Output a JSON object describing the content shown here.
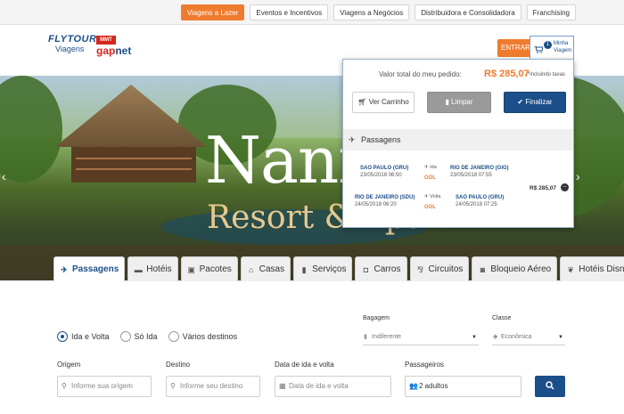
{
  "topnav": {
    "items": [
      {
        "label": "Viagens a Lazer",
        "active": true
      },
      {
        "label": "Eventos e Incentivos",
        "active": false
      },
      {
        "label": "Viagens a Negócios",
        "active": false
      },
      {
        "label": "Distribuidora e Consolidadora",
        "active": false
      },
      {
        "label": "Franchising",
        "active": false
      }
    ]
  },
  "header": {
    "logo_flytour": "FLYTOUR",
    "logo_flytour_sub": "Viagens",
    "logo_mmt": "MMT",
    "logo_gap": "gap",
    "logo_net": "net",
    "entrar_label": "ENTRAR",
    "cart_count": "1",
    "cart_label": "Minha Viagem"
  },
  "hero": {
    "resort_name": "Nann",
    "resort_sub": "Resort & Spa"
  },
  "tabs": [
    {
      "label": "Passagens",
      "icon": "plane-icon",
      "glyph": "✈",
      "active": true
    },
    {
      "label": "Hotéis",
      "icon": "bed-icon",
      "glyph": "▬",
      "active": false
    },
    {
      "label": "Pacotes",
      "icon": "package-icon",
      "glyph": "▣",
      "active": false
    },
    {
      "label": "Casas",
      "icon": "house-icon",
      "glyph": "⌂",
      "active": false
    },
    {
      "label": "Serviços",
      "icon": "service-icon",
      "glyph": "▮",
      "active": false
    },
    {
      "label": "Carros",
      "icon": "car-icon",
      "glyph": "◘",
      "active": false
    },
    {
      "label": "Circuitos",
      "icon": "circuit-icon",
      "glyph": "⅋",
      "active": false
    },
    {
      "label": "Bloqueio Aéreo",
      "icon": "flight-block-icon",
      "glyph": "◙",
      "active": false
    },
    {
      "label": "Hotéis Disney",
      "icon": "disney-icon",
      "glyph": "❦",
      "active": false
    }
  ],
  "search": {
    "trip_types": [
      {
        "label": "Ida e Volta",
        "selected": true
      },
      {
        "label": "Só Ida",
        "selected": false
      },
      {
        "label": "Vários destinos",
        "selected": false
      }
    ],
    "bagagem_label": "Bagagem",
    "bagagem_value": "Indiferente",
    "classe_label": "Classe",
    "classe_value": "Econômica",
    "origem_label": "Origem",
    "origem_placeholder": "Informe sua origem",
    "destino_label": "Destino",
    "destino_placeholder": "Informe seu destino",
    "data_label": "Data de ida e volta",
    "data_placeholder": "Data de ida e volta",
    "passageiros_label": "Passageiros",
    "passageiros_value": "2 adultos"
  },
  "cart_dropdown": {
    "total_label": "Valor total do meu pedido:",
    "total_value": "R$ 285,07",
    "taxes_note": "*incluindo taxas",
    "ver_carrinho": "Ver Carrinho",
    "limpar": "Limpar",
    "finalizar": "Finalizar",
    "section_title": "Passagens",
    "legs": [
      {
        "from_city": "SAO PAULO (GRU)",
        "from_dt": "23/05/2018 06:50",
        "direction": "Ida",
        "airline": "GOL",
        "to_city": "RIO DE JANEIRO (GIG)",
        "to_dt": "23/05/2018 07:55"
      },
      {
        "from_city": "RIO DE JANEIRO (SDU)",
        "from_dt": "24/05/2018 06:20",
        "direction": "Volta",
        "airline": "GOL",
        "to_city": "SAO PAULO (GRU)",
        "to_dt": "24/05/2018 07:25"
      }
    ],
    "leg_price": "R$ 285,07"
  },
  "colors": {
    "brand_blue": "#1b4f8a",
    "accent_orange": "#ef7b2e"
  }
}
